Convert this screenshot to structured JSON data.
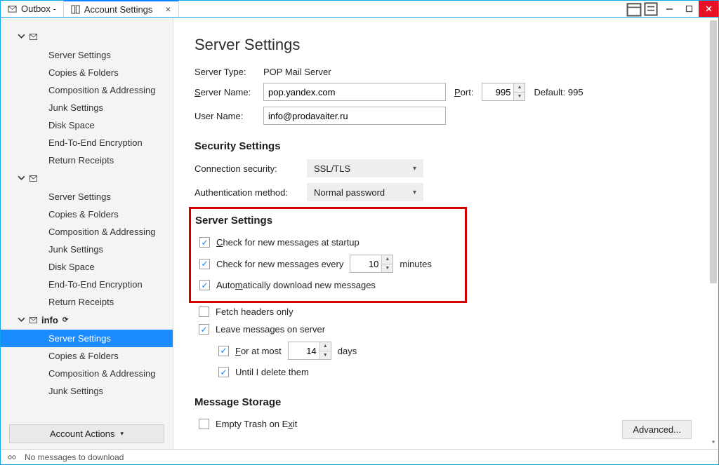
{
  "titlebar": {
    "tab1": "Outbox -",
    "tab2": "Account Settings"
  },
  "sidebar": {
    "account_info_label": "info",
    "items": {
      "server_settings": "Server Settings",
      "copies_folders": "Copies & Folders",
      "composition": "Composition & Addressing",
      "junk": "Junk Settings",
      "disk": "Disk Space",
      "e2e": "End-To-End Encryption",
      "receipts": "Return Receipts"
    },
    "account_actions": "Account Actions"
  },
  "page": {
    "title": "Server Settings",
    "server_type_label": "Server Type:",
    "server_type_value": "POP Mail Server",
    "server_name_label_pre": "S",
    "server_name_label_post": "erver Name:",
    "server_name_value": "pop.yandex.com",
    "port_label_pre": "P",
    "port_label_post": "ort:",
    "port_value": "995",
    "default_port": "Default: 995",
    "user_name_label_pre": "User N",
    "user_name_label_post": "ame:",
    "user_name_value": "info@prodavaiter.ru"
  },
  "security": {
    "heading": "Security Settings",
    "conn_label": "Connection security:",
    "conn_value": "SSL/TLS",
    "auth_label": "Authentication method:",
    "auth_value": "Normal password"
  },
  "server_section": {
    "heading": "Server Settings",
    "check_startup_pre": "C",
    "check_startup_post": "heck for new messages at startup",
    "check_every_pre": "Check for new messages every",
    "check_every_val": "10",
    "check_every_post": "minutes",
    "auto_dl_pre": "Auto",
    "auto_dl_mid": "m",
    "auto_dl_post": "atically download new messages",
    "fetch_headers": "Fetch headers only",
    "leave_msgs": "Leave messages on server",
    "for_at_most_pre": "F",
    "for_at_most_post": "or at most",
    "for_at_most_val": "14",
    "for_at_most_unit": "days",
    "until_delete": "Until I delete them"
  },
  "storage": {
    "heading": "Message Storage",
    "empty_trash_pre": "Empty Trash on E",
    "empty_trash_post": "xit"
  },
  "buttons": {
    "advanced": "Advanced..."
  },
  "statusbar": {
    "text": "No messages to download"
  }
}
